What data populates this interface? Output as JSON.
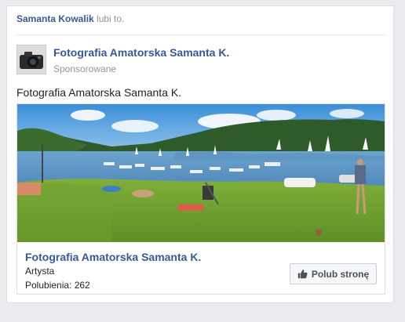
{
  "social_context": {
    "name": "Samanta Kowalik",
    "action": "lubi to."
  },
  "post": {
    "page_name": "Fotografia Amatorska Samanta K.",
    "sponsored_label": "Sponsorowane",
    "text": "Fotografia Amatorska Samanta K."
  },
  "attachment": {
    "title": "Fotografia Amatorska Samanta K.",
    "category": "Artysta",
    "likes": "Polubienia: 262",
    "like_button_label": "Polub stronę",
    "like_icon": "thumbs-up-icon"
  },
  "colors": {
    "link": "#365899",
    "meta": "#90949c",
    "background": "#e9ebee"
  }
}
